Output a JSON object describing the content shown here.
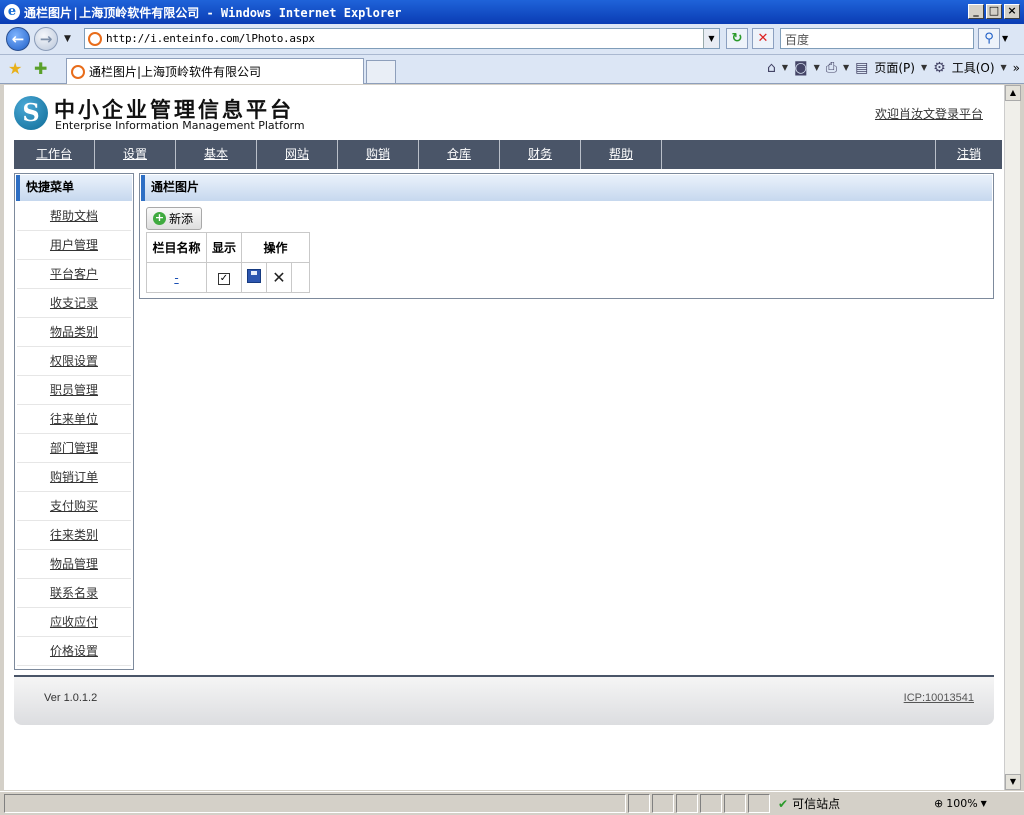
{
  "browser": {
    "window_title": "通栏图片|上海顶岭软件有限公司 - Windows Internet Explorer",
    "url": "http://i.enteinfo.com/lPhoto.aspx",
    "search_placeholder": "百度",
    "tab_title": "通栏图片|上海顶岭软件有限公司",
    "cmd_page": "页面(P)",
    "cmd_tools": "工具(O)",
    "status_zone": "可信站点",
    "zoom": "100%"
  },
  "header": {
    "logo_letter": "S",
    "title": "中小企业管理信息平台",
    "subtitle": "Enterprise Information Management Platform",
    "welcome": "欢迎肖汝文登录平台"
  },
  "nav": {
    "items": [
      "工作台",
      "设置",
      "基本",
      "网站",
      "购销",
      "仓库",
      "财务",
      "帮助"
    ],
    "logout": "注销"
  },
  "sidebar": {
    "title": "快捷菜单",
    "items": [
      "帮助文档",
      "用户管理",
      "平台客户",
      "收支记录",
      "物品类别",
      "权限设置",
      "职员管理",
      "往来单位",
      "部门管理",
      "购销订单",
      "支付购买",
      "往来类别",
      "物品管理",
      "联系名录",
      "应收应付",
      "价格设置"
    ]
  },
  "panel": {
    "title": "通栏图片",
    "add_label": "新添",
    "columns": [
      "栏目名称",
      "显示",
      "操作"
    ],
    "rows": [
      {
        "name": "-",
        "show": true
      }
    ]
  },
  "footer": {
    "version": "Ver 1.0.1.2",
    "icp": "ICP:10013541"
  }
}
